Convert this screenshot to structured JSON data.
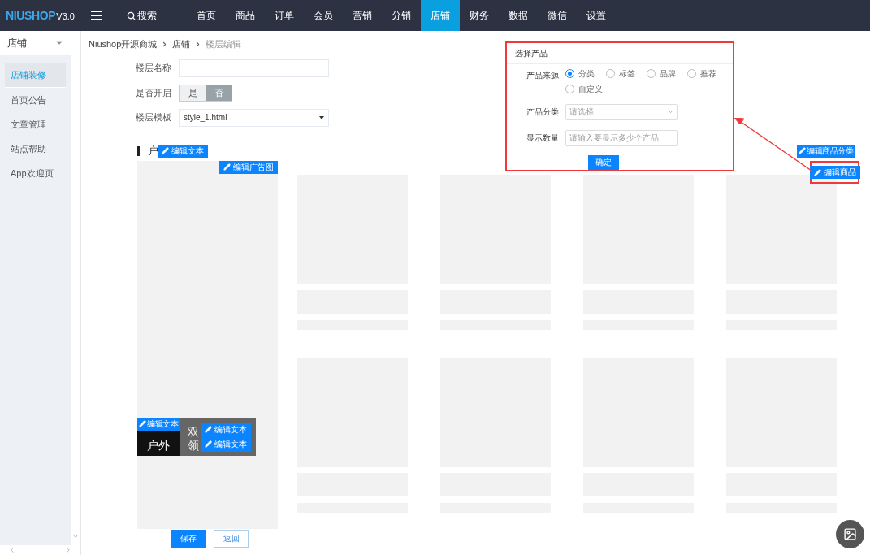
{
  "logo": {
    "brand": "NIUSHOP",
    "version": "V3.0"
  },
  "nav": {
    "search": "搜索",
    "items": [
      {
        "label": "首页",
        "selected": false
      },
      {
        "label": "商品",
        "selected": false
      },
      {
        "label": "订单",
        "selected": false
      },
      {
        "label": "会员",
        "selected": false
      },
      {
        "label": "营销",
        "selected": false
      },
      {
        "label": "分销",
        "selected": false
      },
      {
        "label": "店铺",
        "selected": true
      },
      {
        "label": "财务",
        "selected": false
      },
      {
        "label": "数据",
        "selected": false
      },
      {
        "label": "微信",
        "selected": false
      },
      {
        "label": "设置",
        "selected": false
      }
    ]
  },
  "sidebar": {
    "header": "店铺",
    "items": [
      {
        "label": "店铺装修",
        "selected": true
      },
      {
        "label": "首页公告",
        "selected": false
      },
      {
        "label": "文章管理",
        "selected": false
      },
      {
        "label": "站点帮助",
        "selected": false
      },
      {
        "label": "App欢迎页",
        "selected": false
      }
    ]
  },
  "breadcrumb": [
    {
      "label": "Niushop开源商城",
      "current": false
    },
    {
      "label": "店铺",
      "current": false
    },
    {
      "label": "楼层编辑",
      "current": true
    }
  ],
  "form": {
    "name": {
      "label": "楼层名称"
    },
    "enabled": {
      "label": "是否开启",
      "options": [
        {
          "label": "是",
          "selected": false
        },
        {
          "label": "否",
          "selected": true
        }
      ]
    },
    "template": {
      "label": "楼层模板",
      "value": "style_1.html"
    }
  },
  "floor": {
    "title": "户",
    "edit_title": "编辑文本",
    "edit_ad": "编辑广告图",
    "edit_category": "编辑商品分类",
    "edit_products": "编辑商品",
    "ads": [
      {
        "dark": true,
        "lines": [
          "户外"
        ],
        "edits": [
          "编辑文本"
        ]
      },
      {
        "dark": false,
        "lines": [
          "双",
          "领"
        ],
        "edits": [
          "编辑文本",
          "编辑文本"
        ]
      }
    ]
  },
  "dialog": {
    "title": "选择产品",
    "source": {
      "label": "产品来源",
      "options": [
        {
          "label": "分类",
          "selected": true
        },
        {
          "label": "标签",
          "selected": false
        },
        {
          "label": "品牌",
          "selected": false
        },
        {
          "label": "推荐",
          "selected": false
        },
        {
          "label": "自定义",
          "selected": false
        }
      ]
    },
    "category": {
      "label": "产品分类",
      "placeholder": "请选择"
    },
    "count": {
      "label": "显示数量",
      "placeholder": "请输入要显示多少个产品"
    },
    "confirm": "确定"
  },
  "actions": {
    "save": "保存",
    "back": "返回"
  }
}
